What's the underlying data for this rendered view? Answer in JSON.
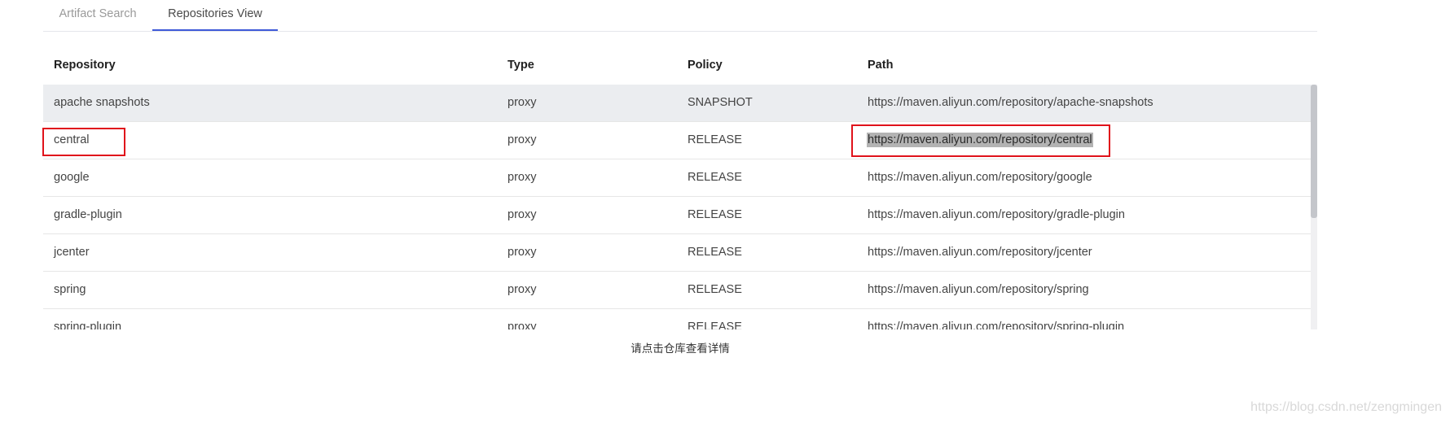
{
  "tabs": [
    {
      "label": "Artifact Search",
      "active": false
    },
    {
      "label": "Repositories View",
      "active": true
    }
  ],
  "table": {
    "headers": {
      "repository": "Repository",
      "type": "Type",
      "policy": "Policy",
      "path": "Path"
    },
    "rows": [
      {
        "repository": "apache snapshots",
        "type": "proxy",
        "policy": "SNAPSHOT",
        "path": "https://maven.aliyun.com/repository/apache-snapshots"
      },
      {
        "repository": "central",
        "type": "proxy",
        "policy": "RELEASE",
        "path": "https://maven.aliyun.com/repository/central"
      },
      {
        "repository": "google",
        "type": "proxy",
        "policy": "RELEASE",
        "path": "https://maven.aliyun.com/repository/google"
      },
      {
        "repository": "gradle-plugin",
        "type": "proxy",
        "policy": "RELEASE",
        "path": "https://maven.aliyun.com/repository/gradle-plugin"
      },
      {
        "repository": "jcenter",
        "type": "proxy",
        "policy": "RELEASE",
        "path": "https://maven.aliyun.com/repository/jcenter"
      },
      {
        "repository": "spring",
        "type": "proxy",
        "policy": "RELEASE",
        "path": "https://maven.aliyun.com/repository/spring"
      },
      {
        "repository": "spring-plugin",
        "type": "proxy",
        "policy": "RELEASE",
        "path": "https://maven.aliyun.com/repository/spring-plugin"
      }
    ]
  },
  "hint": "请点击仓库查看详情",
  "watermark": "https://blog.csdn.net/zengmingen",
  "colors": {
    "active_tab_underline": "#3f5ad8",
    "annotation_box": "#e0121b",
    "hover_row": "#ebedf0",
    "selection_highlight": "#b3b3b3"
  }
}
